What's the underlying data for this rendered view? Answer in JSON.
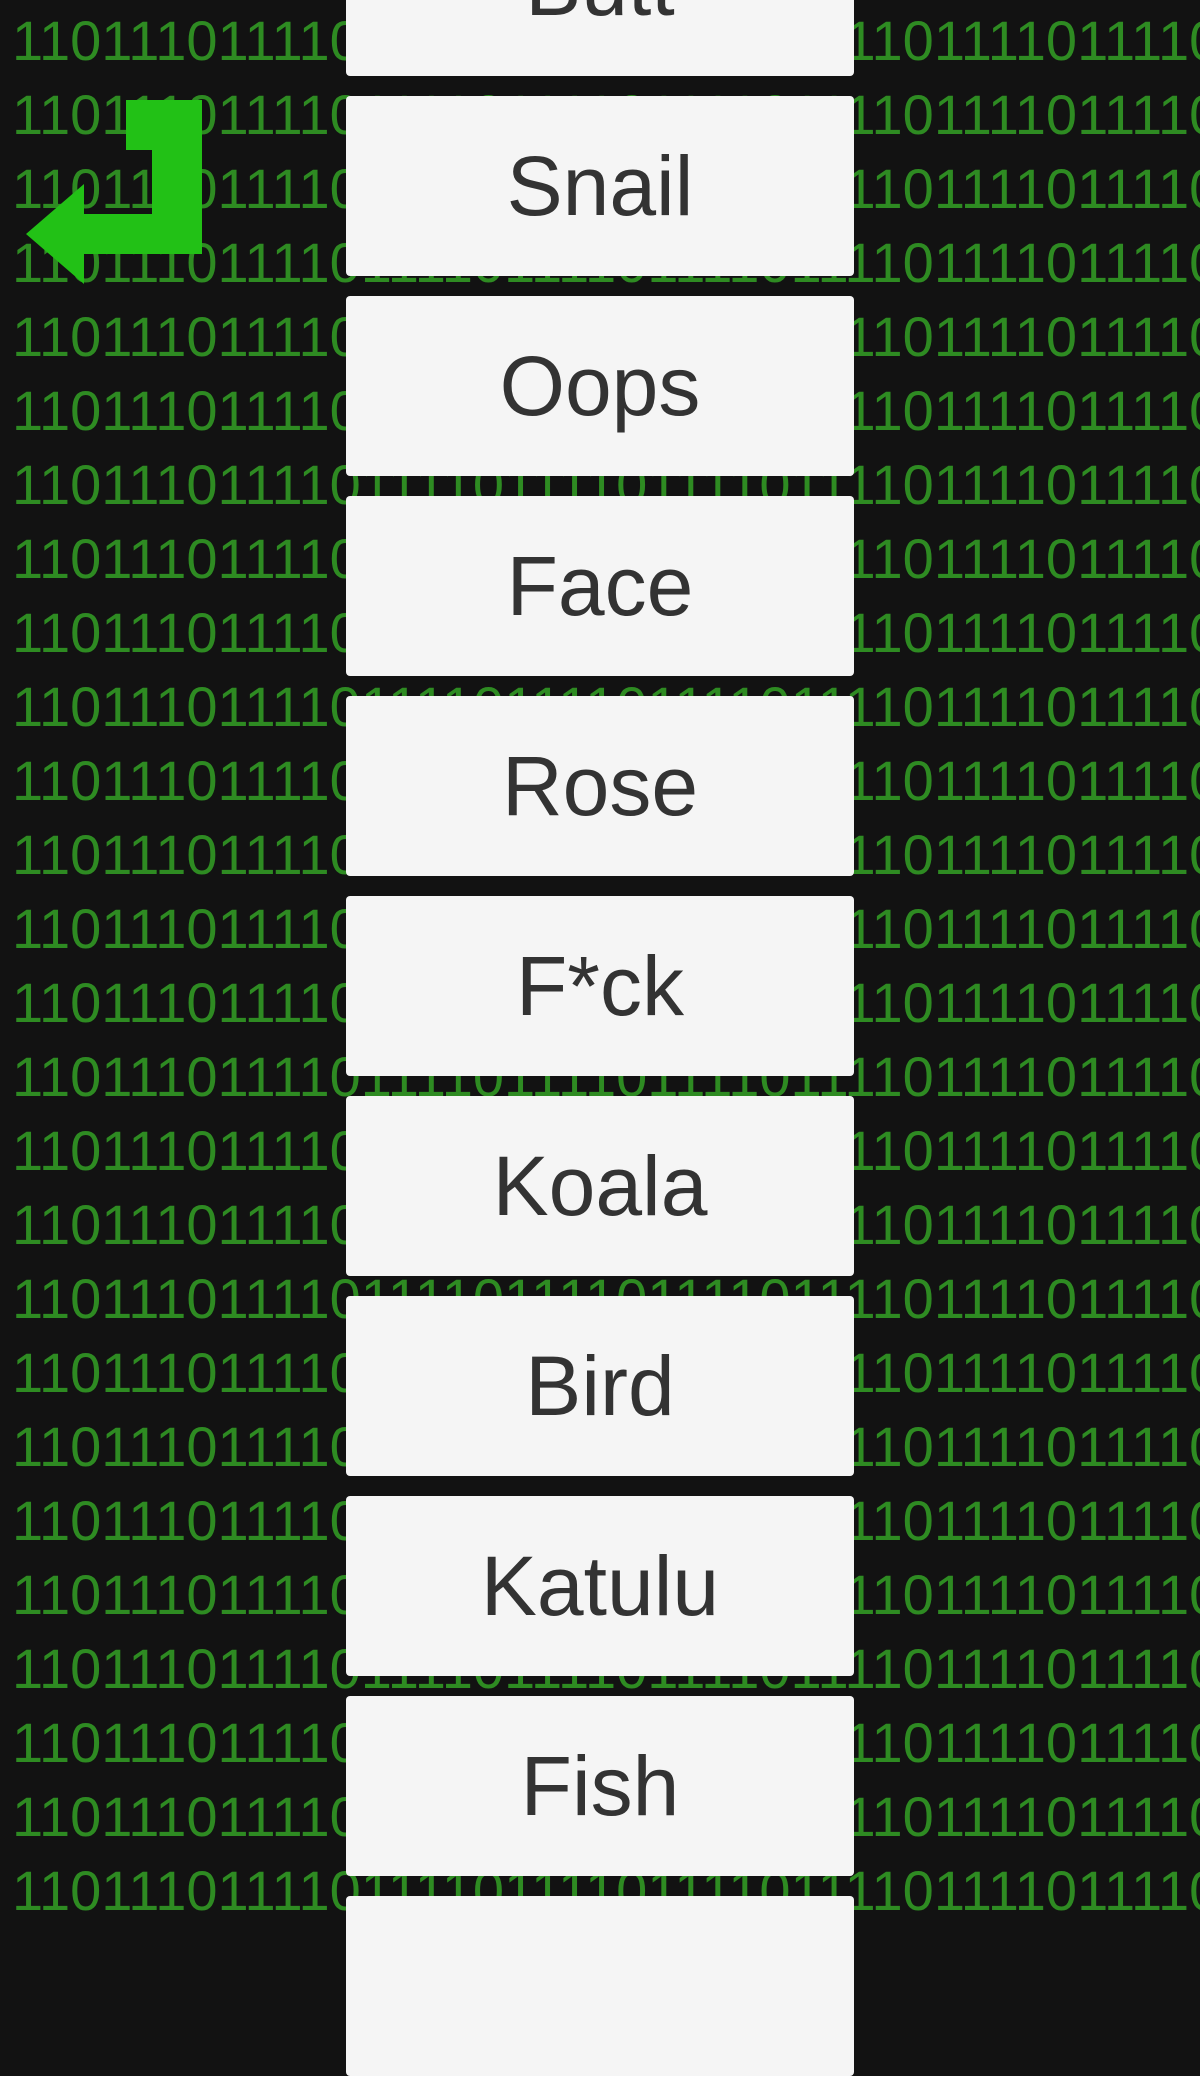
{
  "background": {
    "binary_row_text": "110111011110111101111011110111101111011110111101",
    "text_color": "#2e8b22",
    "page_color": "#121212"
  },
  "back_button": {
    "icon": "return-arrow-icon",
    "color": "#22c116"
  },
  "word_buttons": [
    {
      "label": "Butt"
    },
    {
      "label": "Snail"
    },
    {
      "label": "Oops"
    },
    {
      "label": "Face"
    },
    {
      "label": "Rose"
    },
    {
      "label": "F*ck"
    },
    {
      "label": "Koala"
    },
    {
      "label": "Bird"
    },
    {
      "label": "Katulu"
    },
    {
      "label": "Fish"
    },
    {
      "label": ""
    }
  ]
}
